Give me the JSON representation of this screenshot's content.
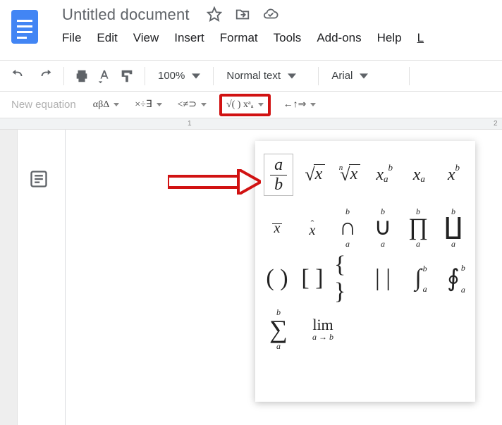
{
  "header": {
    "title": "Untitled document",
    "menus": [
      "File",
      "Edit",
      "View",
      "Insert",
      "Format",
      "Tools",
      "Add-ons",
      "Help",
      "L"
    ]
  },
  "toolbar": {
    "zoom": "100%",
    "style": "Normal text",
    "font": "Arial"
  },
  "equation_bar": {
    "new_label": "New equation",
    "cat_greek": "αβΔ",
    "cat_ops": "×÷∃",
    "cat_rel": "<≠⊃",
    "cat_math": "√( ) xᵃₐ",
    "cat_arrows": "←↑⇒"
  },
  "math_panel": {
    "frac_a": "a",
    "frac_b": "b",
    "sqrt_x": "x",
    "nroot_n": "n",
    "nroot_x": "x",
    "xab_x": "x",
    "xab_a": "a",
    "xab_b": "b",
    "xa_x": "x",
    "xa_a": "a",
    "xb_x": "x",
    "xb_b": "b",
    "barx": "x",
    "hatx": "x",
    "bigcap": "∩",
    "bigcup": "∪",
    "bigprod": "∏",
    "bigcoprod": "∐",
    "sub_a": "a",
    "sup_b": "b",
    "paren": "( )",
    "brack": "[ ]",
    "brace": "{ }",
    "vert": "| |",
    "int": "∫",
    "oint": "∮",
    "sigma": "∑",
    "lim": "lim",
    "lim_sub": "a → b"
  },
  "ruler": {
    "mark1": "1",
    "mark2": "2"
  }
}
